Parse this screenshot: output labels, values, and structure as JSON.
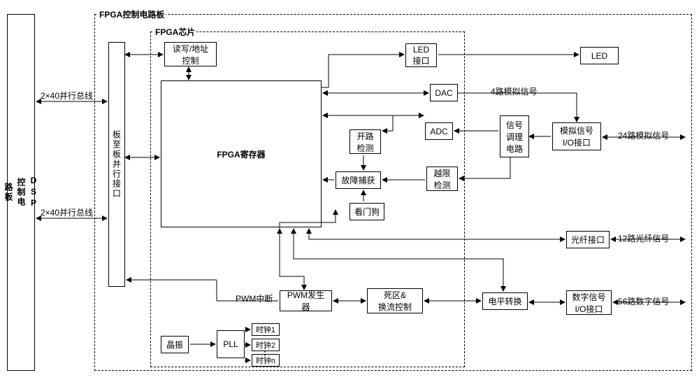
{
  "dsp_board": "DSP\n控制电\n路板",
  "bus_top": "2×40并行总线",
  "bus_bottom": "2×40并行总线",
  "fpga_board_title": "FPGA控制电路板",
  "fpga_chip_title": "FPGA芯片",
  "b2b_interface": "板至板并行接口",
  "rw_addr": "读写/地址\n控制",
  "fpga_reg": "FPGA寄存器",
  "open_detect": "开路\n检测",
  "fault_capture": "故障捕获",
  "watchdog": "看门狗",
  "pwm_int": "PWM中断",
  "pwm_gen": "PWM发生器",
  "deadzone": "死区&\n换流控制",
  "level_conv": "电平转换",
  "pll": "PLL",
  "osc": "晶振",
  "clock1": "时钟1",
  "clock2": "时钟2",
  "clockn": "时钟n",
  "led_if": "LED\n接口",
  "led": "LED",
  "dac": "DAC",
  "adc": "ADC",
  "over_limit": "越限\n检测",
  "signal_cond": "信号\n调理\n电路",
  "analog_io": "模拟信号\nI/O接口",
  "fiber_if": "光纤接口",
  "digital_io": "数字信号\nI/O接口",
  "sig_4analog": "4路模拟信号",
  "sig_24analog": "24路模拟信号",
  "sig_12fiber": "12路光纤信号",
  "sig_56digital": "56路数字信号"
}
